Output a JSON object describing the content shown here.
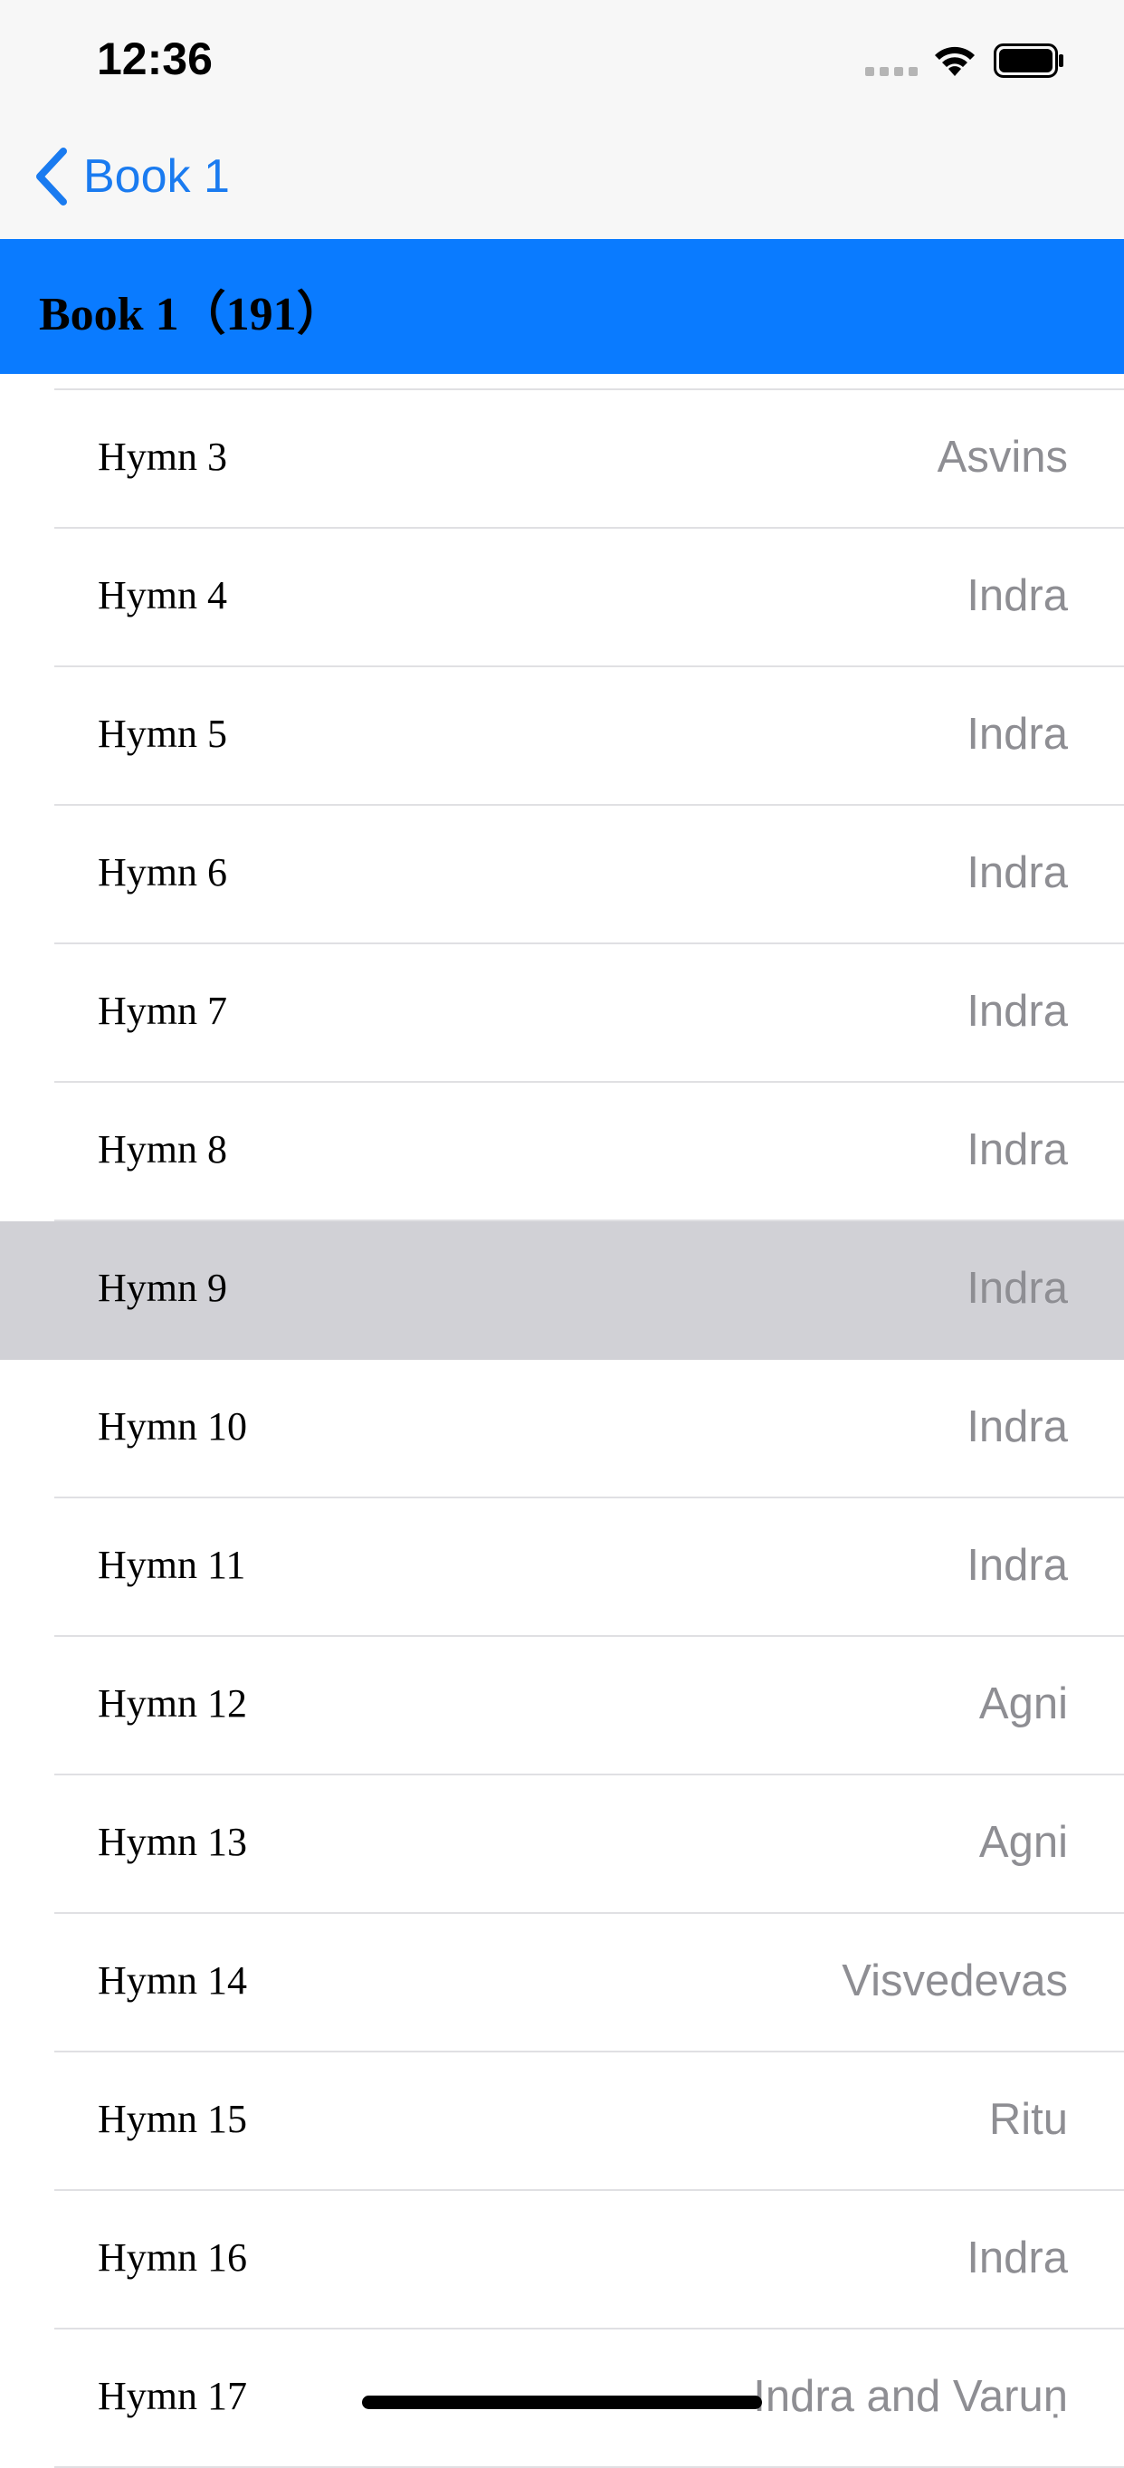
{
  "status_bar": {
    "time": "12:36"
  },
  "nav": {
    "back_label": "Book 1"
  },
  "section": {
    "title": "Book 1（191）"
  },
  "rows": [
    {
      "title": "Hymn 3",
      "detail": "Asvins"
    },
    {
      "title": "Hymn 4",
      "detail": "Indra"
    },
    {
      "title": "Hymn 5",
      "detail": "Indra"
    },
    {
      "title": "Hymn 6",
      "detail": "Indra"
    },
    {
      "title": "Hymn 7",
      "detail": "Indra"
    },
    {
      "title": "Hymn 8",
      "detail": "Indra"
    },
    {
      "title": "Hymn 9",
      "detail": "Indra",
      "selected": true
    },
    {
      "title": "Hymn 10",
      "detail": "Indra"
    },
    {
      "title": "Hymn 11",
      "detail": "Indra"
    },
    {
      "title": "Hymn 12",
      "detail": "Agni"
    },
    {
      "title": "Hymn 13",
      "detail": "Agni"
    },
    {
      "title": "Hymn 14",
      "detail": "Visvedevas"
    },
    {
      "title": "Hymn 15",
      "detail": "Ritu"
    },
    {
      "title": "Hymn 16",
      "detail": "Indra"
    },
    {
      "title": "Hymn 17",
      "detail": "Indra and Varuṇ"
    }
  ],
  "colors": {
    "accent": "#1a7bf0",
    "header_bg": "#0a7bff",
    "selected_row": "#d1d1d6",
    "detail_text": "#8e8e93"
  }
}
